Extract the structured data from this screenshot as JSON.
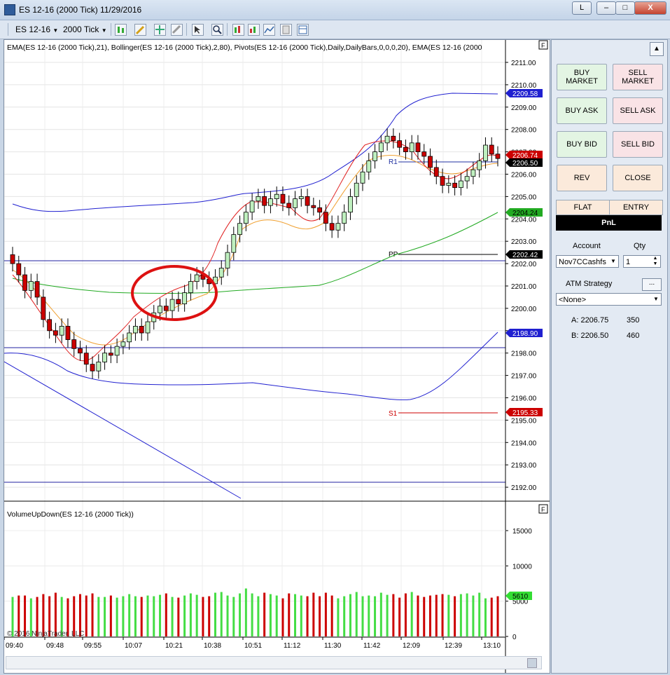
{
  "window": {
    "title": "ES 12-16 (2000 Tick)  11/29/2016",
    "btn_l": "L",
    "btn_min": "–",
    "btn_max": "□",
    "btn_close": "X"
  },
  "toolbar": {
    "instrument": "ES 12-16",
    "period": "2000 Tick"
  },
  "chart": {
    "indicator_label": "EMA(ES 12-16 (2000 Tick),21), Bollinger(ES 12-16 (2000 Tick),2,80), Pivots(ES 12-16 (2000 Tick),Daily,DailyBars,0,0,0,20), EMA(ES 12-16 (2000",
    "volume_label": "VolumeUpDown(ES 12-16 (2000 Tick))",
    "copyright": "© 2016 NinjaTrader, LLC",
    "panel_btn": "F",
    "price_ticks": [
      "2211.00",
      "2210.00",
      "2209.00",
      "2208.00",
      "2207.00",
      "2206.00",
      "2205.00",
      "2204.00",
      "2203.00",
      "2202.00",
      "2201.00",
      "2200.00",
      "2199.00",
      "2198.00",
      "2197.00",
      "2196.00",
      "2195.00",
      "2194.00",
      "2193.00",
      "2192.00"
    ],
    "volume_ticks": [
      "15000",
      "10000",
      "5000",
      "0"
    ],
    "time_labels": [
      "09:40",
      "09:48",
      "09:55",
      "10:07",
      "10:21",
      "10:38",
      "10:51",
      "11:12",
      "11:30",
      "11:42",
      "12:09",
      "12:39",
      "13:10"
    ],
    "pivot_r1": "R1",
    "pivot_pp": "PP",
    "pivot_s1": "S1",
    "markers": {
      "upper_band": "2209.58",
      "r1_hidden": "2206.74",
      "last": "2206.50",
      "ema": "2204.24",
      "pp": "2202.42",
      "lower_band": "2198.90",
      "s1": "2195.33",
      "volume": "5610"
    },
    "colors": {
      "up_candle": "#bff0bf",
      "down_candle": "#cc0000",
      "ema_fast": "#e02020",
      "ema_slow": "#f0a030",
      "ema_long": "#22aa22",
      "bollinger": "#2020d0",
      "circle": "#dd1111"
    }
  },
  "chart_data": {
    "type": "candlestick",
    "ylim": [
      2191.5,
      2211.5
    ],
    "y2lim": [
      0,
      18000
    ],
    "bars": 80,
    "ohlc_close": [
      2202.0,
      2201.5,
      2200.8,
      2201.2,
      2200.5,
      2199.5,
      2199.0,
      2198.8,
      2199.2,
      2198.6,
      2198.2,
      2198.0,
      2197.5,
      2197.2,
      2197.6,
      2198.0,
      2197.9,
      2198.3,
      2198.5,
      2198.9,
      2199.2,
      2198.9,
      2199.4,
      2199.8,
      2200.1,
      2199.9,
      2200.4,
      2200.2,
      2200.7,
      2201.2,
      2201.5,
      2201.3,
      2201.1,
      2201.4,
      2201.8,
      2202.5,
      2203.3,
      2203.8,
      2204.3,
      2204.8,
      2205.0,
      2204.6,
      2204.9,
      2205.1,
      2204.7,
      2204.5,
      2204.9,
      2205.0,
      2204.6,
      2204.5,
      2204.3,
      2203.8,
      2203.5,
      2203.8,
      2204.3,
      2205.0,
      2205.6,
      2206.1,
      2206.6,
      2207.0,
      2207.4,
      2207.7,
      2207.5,
      2207.2,
      2207.0,
      2207.4,
      2207.0,
      2206.8,
      2206.3,
      2205.9,
      2205.5,
      2205.6,
      2205.4,
      2205.7,
      2205.9,
      2206.2,
      2206.6,
      2207.3,
      2206.9,
      2206.7
    ],
    "volume": [
      5600,
      5800,
      5800,
      5400,
      5600,
      6000,
      5700,
      6200,
      5600,
      5400,
      5700,
      6000,
      5800,
      6100,
      5600,
      5600,
      5800,
      5500,
      5700,
      6000,
      5700,
      5600,
      5800,
      5700,
      5900,
      6100,
      5600,
      5500,
      5800,
      6100,
      5900,
      5600,
      5700,
      6200,
      6300,
      5800,
      5600,
      6100,
      6800,
      6100,
      5700,
      6200,
      6000,
      5800,
      5400,
      6100,
      6000,
      5800,
      5700,
      6200,
      5700,
      6200,
      5800,
      5400,
      5700,
      6000,
      6300,
      5700,
      5800,
      5700,
      6200,
      5900,
      6000,
      5500,
      6100,
      6300,
      5800,
      5600,
      5800,
      5900,
      6000,
      5900,
      5700,
      6000,
      6100,
      5800,
      6200,
      5400,
      5500,
      5700
    ]
  },
  "right_panel": {
    "buy_market": "BUY MARKET",
    "sell_market": "SELL MARKET",
    "buy_ask": "BUY ASK",
    "sell_ask": "SELL ASK",
    "buy_bid": "BUY BID",
    "sell_bid": "SELL BID",
    "rev": "REV",
    "close": "CLOSE",
    "flat": "FLAT",
    "entry": "ENTRY",
    "pnl": "PnL",
    "account_label": "Account",
    "qty_label": "Qty",
    "account_value": "Nov7CCashfs",
    "qty_value": "1",
    "atm_label": "ATM Strategy",
    "atm_btn": "...",
    "atm_value": "<None>",
    "ask_label": "A: 2206.75",
    "ask_size": "350",
    "bid_label": "B: 2206.50",
    "bid_size": "460"
  }
}
